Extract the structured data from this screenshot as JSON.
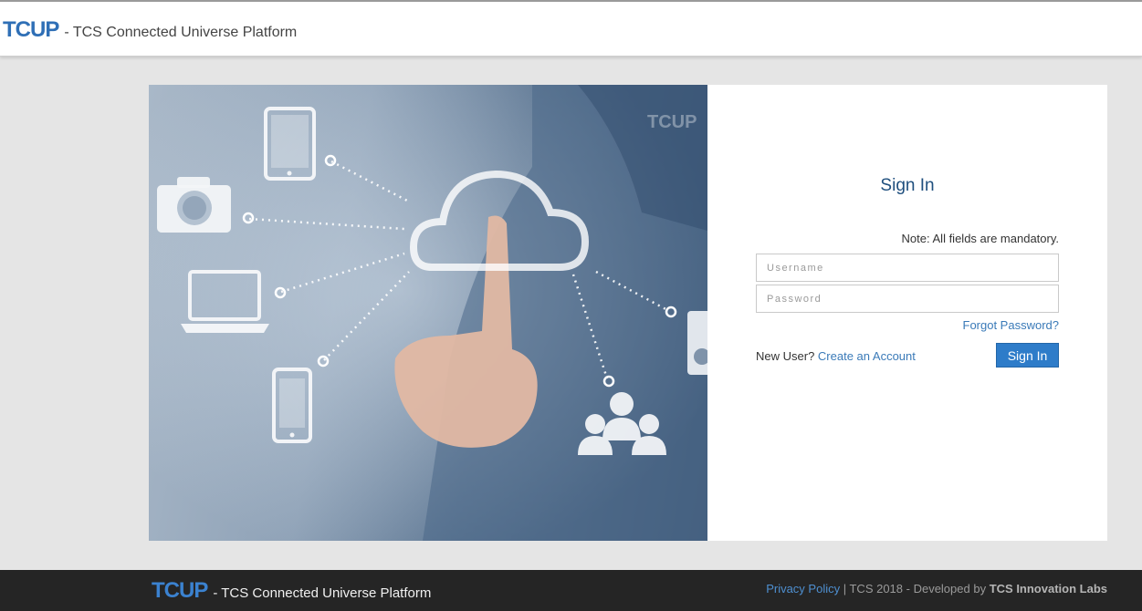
{
  "header": {
    "logo": "TCUP",
    "tagline": "- TCS Connected Universe Platform"
  },
  "hero": {
    "watermark": "TCUP"
  },
  "login": {
    "title": "Sign In",
    "note": "Note: All fields are mandatory.",
    "username_placeholder": "Username",
    "password_placeholder": "Password",
    "forgot_password": "Forgot Password?",
    "new_user_prefix": "New User?",
    "create_account": "Create an Account",
    "sign_in_button": "Sign In"
  },
  "footer": {
    "logo": "TCUP",
    "tagline": "- TCS Connected Universe Platform",
    "privacy_policy": "Privacy Policy",
    "copyright": "| TCS 2018 - Developed by",
    "developer": "TCS Innovation Labs"
  },
  "colors": {
    "brand_blue": "#2f6fb6",
    "button_blue": "#2e7cc9",
    "link_blue": "#3a7ab8",
    "footer_bg": "#252525"
  }
}
